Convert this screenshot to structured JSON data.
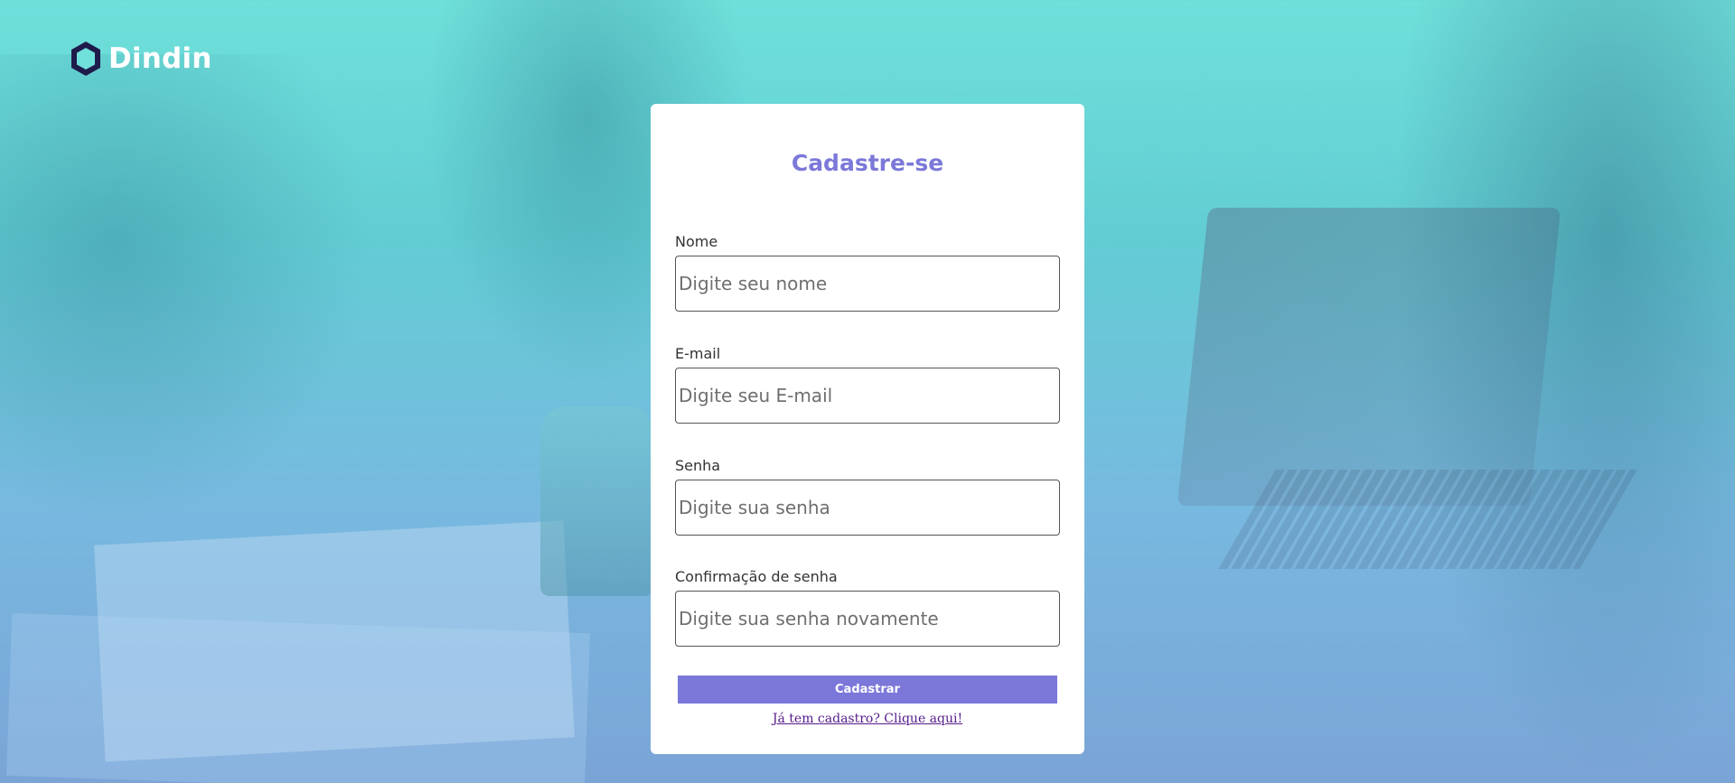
{
  "app": {
    "brand_name": "Dindin",
    "logo_icon": "hexagon-logo-icon",
    "colors": {
      "accent": "#7b78d9",
      "logo_outline": "#1e1b4b",
      "logo_fill": "#6fe0da",
      "card_background": "#ffffff"
    }
  },
  "form": {
    "title": "Cadastre-se",
    "fields": [
      {
        "label": "Nome",
        "placeholder": "Digite seu nome",
        "value": ""
      },
      {
        "label": "E-mail",
        "placeholder": "Digite seu E-mail",
        "value": ""
      },
      {
        "label": "Senha",
        "placeholder": "Digite sua senha",
        "value": ""
      },
      {
        "label": "Confirmação de senha",
        "placeholder": "Digite sua senha novamente",
        "value": ""
      }
    ],
    "submit_label": "Cadastrar",
    "login_link_text": "Já tem cadastro? Clique aqui!"
  }
}
